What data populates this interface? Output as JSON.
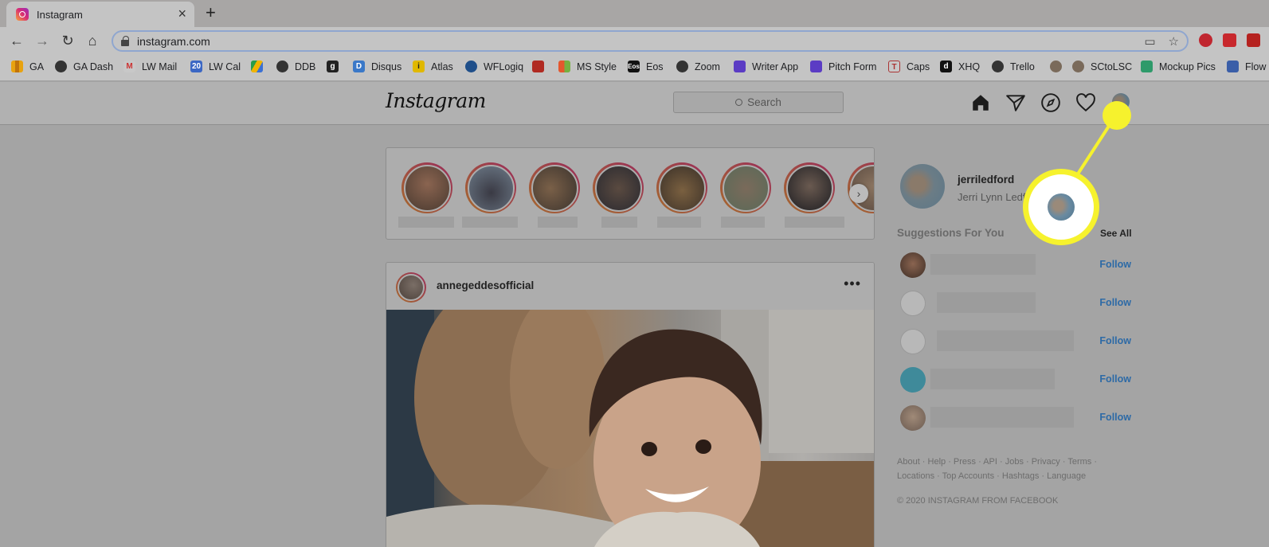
{
  "browser": {
    "tab_title": "Instagram",
    "url": "instagram.com",
    "bookmarks": [
      "GA",
      "GA Dash",
      "LW Mail",
      "LW Cal",
      "DDB",
      "Disqus",
      "Atlas",
      "WFLogiq",
      "MS Style",
      "Eos",
      "Zoom",
      "Writer App",
      "Pitch Form",
      "Caps",
      "XHQ",
      "Trello",
      "SCtoLSC",
      "Mockup Pics",
      "Flow"
    ],
    "bookmark_icon_labels": {
      "lwcal": "20",
      "g": "g",
      "disqus": "D",
      "eos": "Eos",
      "caps": "T",
      "xhq": "d"
    }
  },
  "instagram": {
    "logo": "Instagram",
    "search_placeholder": "Search",
    "post": {
      "username": "annegeddesofficial",
      "more": "•••"
    },
    "profile": {
      "username": "jerriledford",
      "full_name": "Jerri Lynn Ledfor"
    },
    "suggestions": {
      "title": "Suggestions For You",
      "see_all": "See All",
      "follow_label": "Follow"
    },
    "footer": {
      "links": "About · Help · Press · API · Jobs · Privacy · Terms · Locations · Top Accounts · Hashtags · Language",
      "copyright": "© 2020 INSTAGRAM FROM FACEBOOK"
    }
  },
  "colors": {
    "callout": "#f6f22d",
    "follow": "#2d6aa6"
  }
}
